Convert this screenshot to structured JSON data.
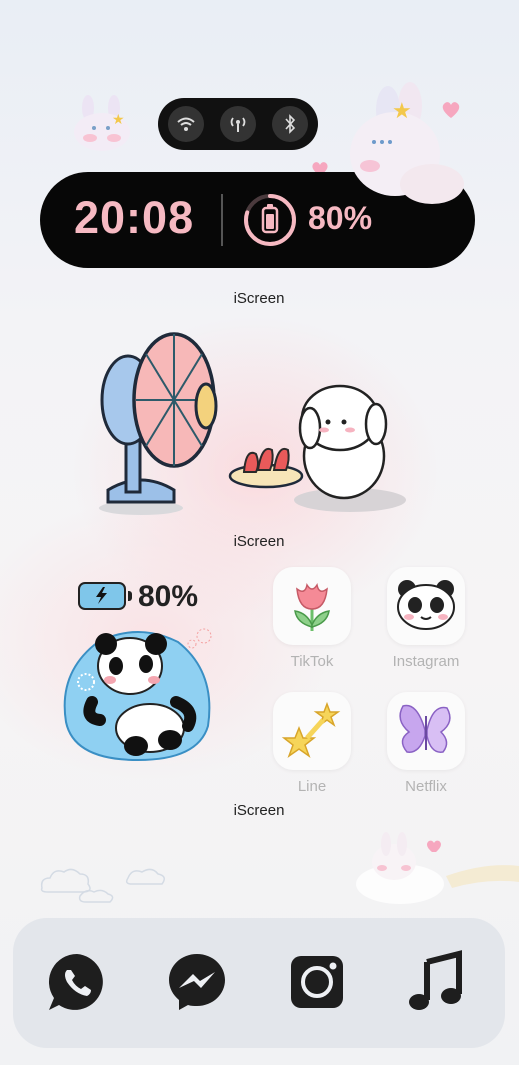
{
  "status_widget": {
    "time": "20:08",
    "battery_percent": "80%",
    "battery_level": 0.8,
    "toggles": [
      {
        "name": "wifi-icon"
      },
      {
        "name": "cellular-icon"
      },
      {
        "name": "bluetooth-icon"
      }
    ],
    "accent_color": "#f6b9c2"
  },
  "captions": {
    "widget_1": "iScreen",
    "widget_2": "iScreen",
    "widget_3": "iScreen"
  },
  "battery_widget": {
    "percent": "80%",
    "level": 0.8
  },
  "apps": [
    {
      "label": "TikTok",
      "icon": "tulip-icon"
    },
    {
      "label": "Instagram",
      "icon": "panda-face-icon"
    },
    {
      "label": "Line",
      "icon": "stars-icon"
    },
    {
      "label": "Netflix",
      "icon": "butterfly-icon"
    }
  ],
  "dock": [
    {
      "icon": "whatsapp-icon"
    },
    {
      "icon": "messenger-icon"
    },
    {
      "icon": "camera-icon"
    },
    {
      "icon": "music-note-icon"
    }
  ]
}
